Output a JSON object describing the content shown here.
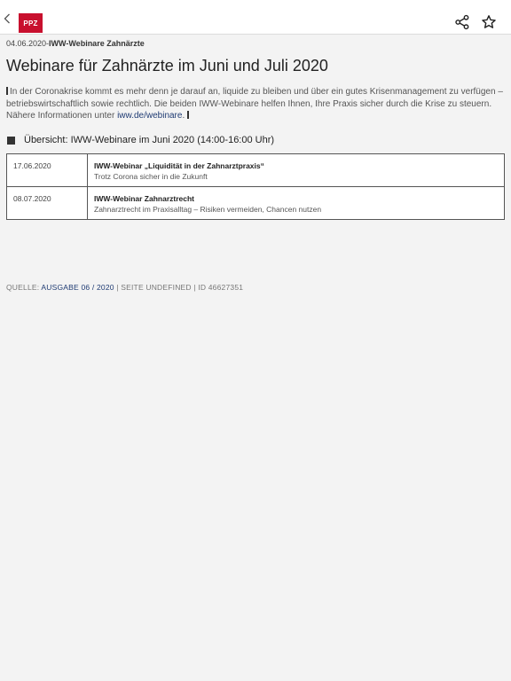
{
  "header": {
    "logo_text": "PPZ",
    "brand_color": "#c8102e"
  },
  "article": {
    "date": "04.06.2020",
    "separator": "-",
    "category": "IWW-Webinare Zahnärzte",
    "title": "Webinare für Zahnärzte im Juni und Juli 2020",
    "intro_text": "In der Coronakrise kommt es mehr denn je darauf an, liquide zu bleiben und über ein gutes Krisenmanagement zu verfügen – betriebswirtschaftlich sowie rechtlich. Die beiden IWW-Webinare helfen Ihnen, Ihre Praxis sicher durch die Krise zu steuern. Nähere Informationen unter ",
    "intro_link": "iww.de/webinare",
    "intro_end": ".",
    "section_heading": "Übersicht: IWW-Webinare im Juni 2020 (14:00-16:00 Uhr)",
    "webinars": [
      {
        "date": "17.06.2020",
        "title": "IWW-Webinar „Liquidität in der Zahnarztpraxis“",
        "subtitle": "Trotz Corona sicher in die Zukunft"
      },
      {
        "date": "08.07.2020",
        "title": "IWW-Webinar Zahnarztrecht",
        "subtitle": "Zahnarztrecht im Praxisalltag – Risiken vermeiden, Chancen nutzen"
      }
    ]
  },
  "source": {
    "label": "QUELLE: ",
    "issue_link": "AUSGABE 06 / 2020",
    "rest": " | SEITE UNDEFINED | ID 46627351"
  },
  "icons": {
    "back": "chevron-left-icon",
    "share": "share-icon",
    "bookmark": "star-icon"
  }
}
